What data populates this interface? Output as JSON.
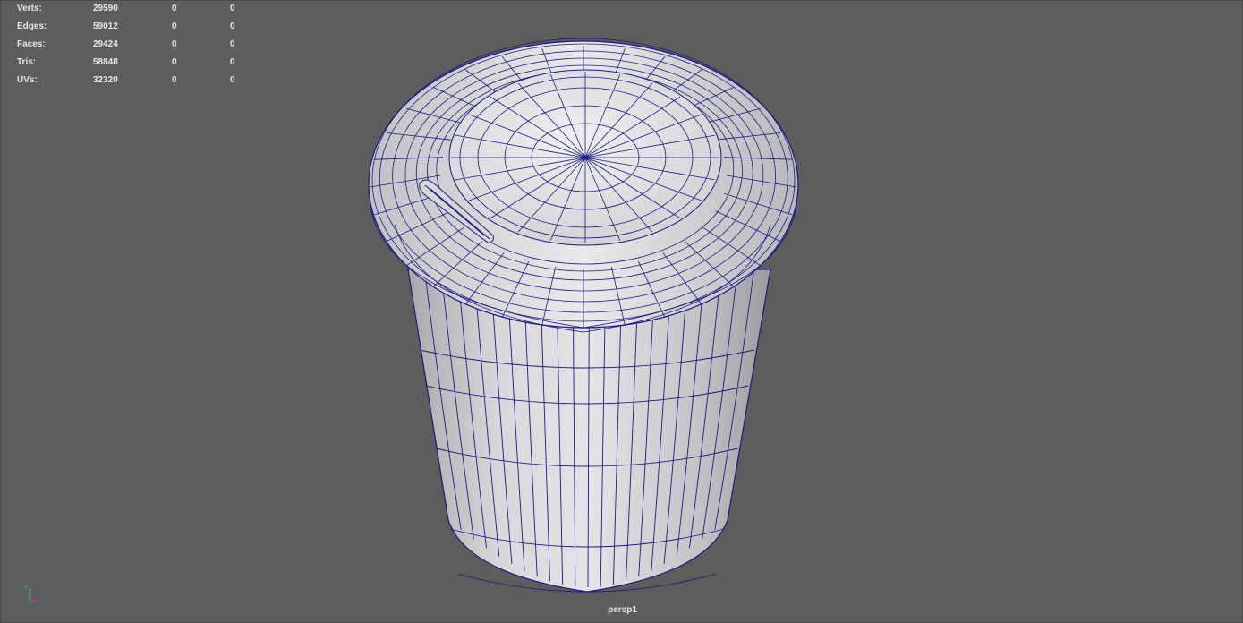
{
  "hud": {
    "rows": [
      {
        "label": "Verts:",
        "values": [
          "29590",
          "0",
          "0"
        ]
      },
      {
        "label": "Edges:",
        "values": [
          "59012",
          "0",
          "0"
        ]
      },
      {
        "label": "Faces:",
        "values": [
          "29424",
          "0",
          "0"
        ]
      },
      {
        "label": "Tris:",
        "values": [
          "58848",
          "0",
          "0"
        ]
      },
      {
        "label": "UVs:",
        "values": [
          "32320",
          "0",
          "0"
        ]
      }
    ]
  },
  "viewport": {
    "camera_name": "persp1",
    "background_color": "#5d5d5d",
    "wireframe_color": "#1a1a80",
    "shaded_color": "#dcdcde"
  },
  "axis_gizmo": {
    "labels": [
      "y",
      "z"
    ],
    "colors": {
      "x": "#e04040",
      "y": "#40c040",
      "z": "#4060e0"
    }
  }
}
